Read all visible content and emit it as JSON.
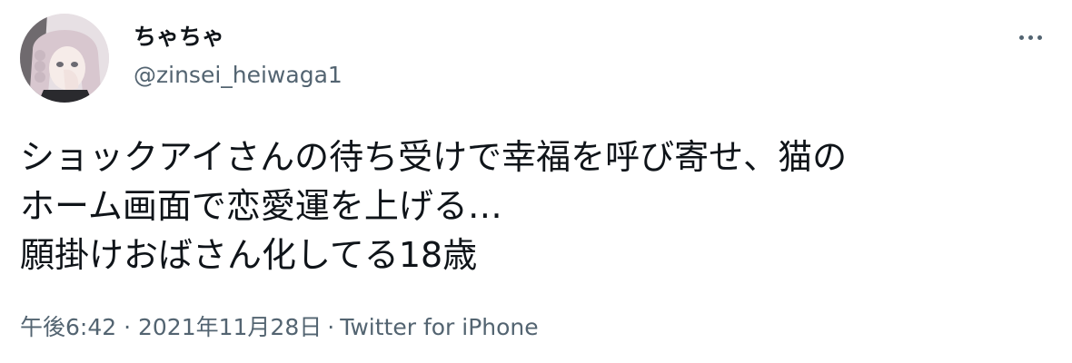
{
  "user": {
    "display_name": "ちゃちゃ",
    "handle": "@zinsei_heiwaga1"
  },
  "tweet": {
    "lines": [
      "ショックアイさんの待ち受けで幸福を呼び寄せ、猫の",
      "ホーム画面で恋愛運を上げる…",
      "願掛けおばさん化してる18歳"
    ]
  },
  "meta": {
    "time": "午後6:42",
    "separator": "·",
    "date": "2021年11月28日",
    "source": "Twitter for iPhone"
  },
  "icons": {
    "more": "more-horizontal-icon",
    "avatar": "anime-avatar-image"
  },
  "colors": {
    "text": "#0f1419",
    "secondary": "#536471",
    "background": "#ffffff"
  }
}
